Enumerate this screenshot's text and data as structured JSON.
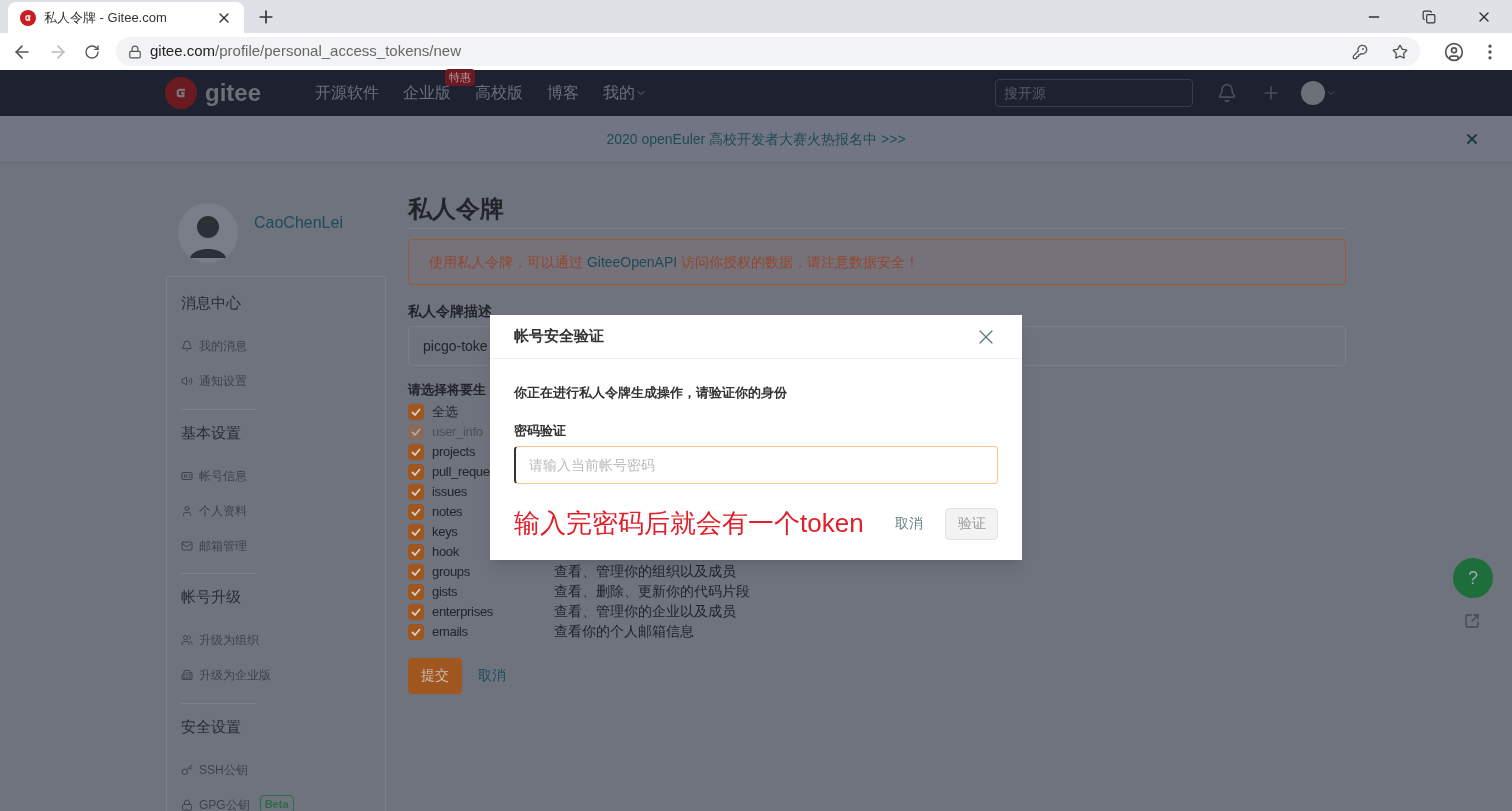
{
  "browser": {
    "tab_title": "私人令牌 - Gitee.com",
    "url_host": "gitee.com",
    "url_path": "/profile/personal_access_tokens/new"
  },
  "navbar": {
    "logo": "gitee",
    "items": [
      {
        "label": "开源软件",
        "has_menu": false
      },
      {
        "label": "企业版",
        "badge": "特惠",
        "has_menu": false
      },
      {
        "label": "高校版",
        "has_menu": false
      },
      {
        "label": "博客",
        "has_menu": false
      },
      {
        "label": "我的",
        "has_menu": true
      }
    ],
    "search": {
      "placeholder": "搜开源"
    }
  },
  "banner": {
    "text": "2020 openEuler 高校开发者大赛火热报名中 >>>"
  },
  "sidebar": {
    "user": "CaoChenLei",
    "sections": [
      {
        "title": "消息中心",
        "items": [
          {
            "label": "我的消息"
          },
          {
            "label": "通知设置"
          }
        ]
      },
      {
        "title": "基本设置",
        "items": [
          {
            "label": "帐号信息"
          },
          {
            "label": "个人资料"
          },
          {
            "label": "邮箱管理"
          }
        ]
      },
      {
        "title": "帐号升级",
        "items": [
          {
            "label": "升级为组织"
          },
          {
            "label": "升级为企业版"
          }
        ]
      },
      {
        "title": "安全设置",
        "items": [
          {
            "label": "SSH公钥"
          },
          {
            "label": "GPG公钥",
            "badge": "Beta"
          }
        ]
      }
    ]
  },
  "main": {
    "title": "私人令牌",
    "alert": {
      "before": "使用私人令牌，可以通过 ",
      "link": "GiteeOpenAPI",
      "after": " 访问你授权的数据，请注意数据安全！"
    },
    "description": {
      "label": "私人令牌描述",
      "value": "picgo-toke"
    },
    "scopes_label": "请选择将要生",
    "scopes": [
      {
        "name": "全选",
        "checked": true,
        "disabled": false
      },
      {
        "name": "user_info",
        "checked": true,
        "disabled": true
      },
      {
        "name": "projects",
        "checked": true,
        "disabled": false
      },
      {
        "name": "pull_reque",
        "checked": true,
        "disabled": false
      },
      {
        "name": "issues",
        "checked": true,
        "disabled": false
      },
      {
        "name": "notes",
        "checked": true,
        "disabled": false
      },
      {
        "name": "keys",
        "checked": true,
        "disabled": false
      },
      {
        "name": "hook",
        "checked": true,
        "disabled": false
      },
      {
        "name": "groups",
        "checked": true,
        "disabled": false,
        "description": "查看、管理你的组织以及成员"
      },
      {
        "name": "gists",
        "checked": true,
        "disabled": false,
        "description": "查看、删除、更新你的代码片段"
      },
      {
        "name": "enterprises",
        "checked": true,
        "disabled": false,
        "description": "查看、管理你的企业以及成员"
      },
      {
        "name": "emails",
        "checked": true,
        "disabled": false,
        "description": "查看你的个人邮箱信息"
      }
    ],
    "submit": "提交",
    "cancel": "取消"
  },
  "modal": {
    "title": "帐号安全验证",
    "message": "你正在进行私人令牌生成操作，请验证你的身份",
    "field_label": "密码验证",
    "password": {
      "placeholder": "请输入当前帐号密码",
      "focused": true
    },
    "annotation": "输入完密码后就会有一个token",
    "cancel": "取消",
    "confirm": {
      "label": "验证",
      "disabled": true
    }
  },
  "help_button": "?"
}
